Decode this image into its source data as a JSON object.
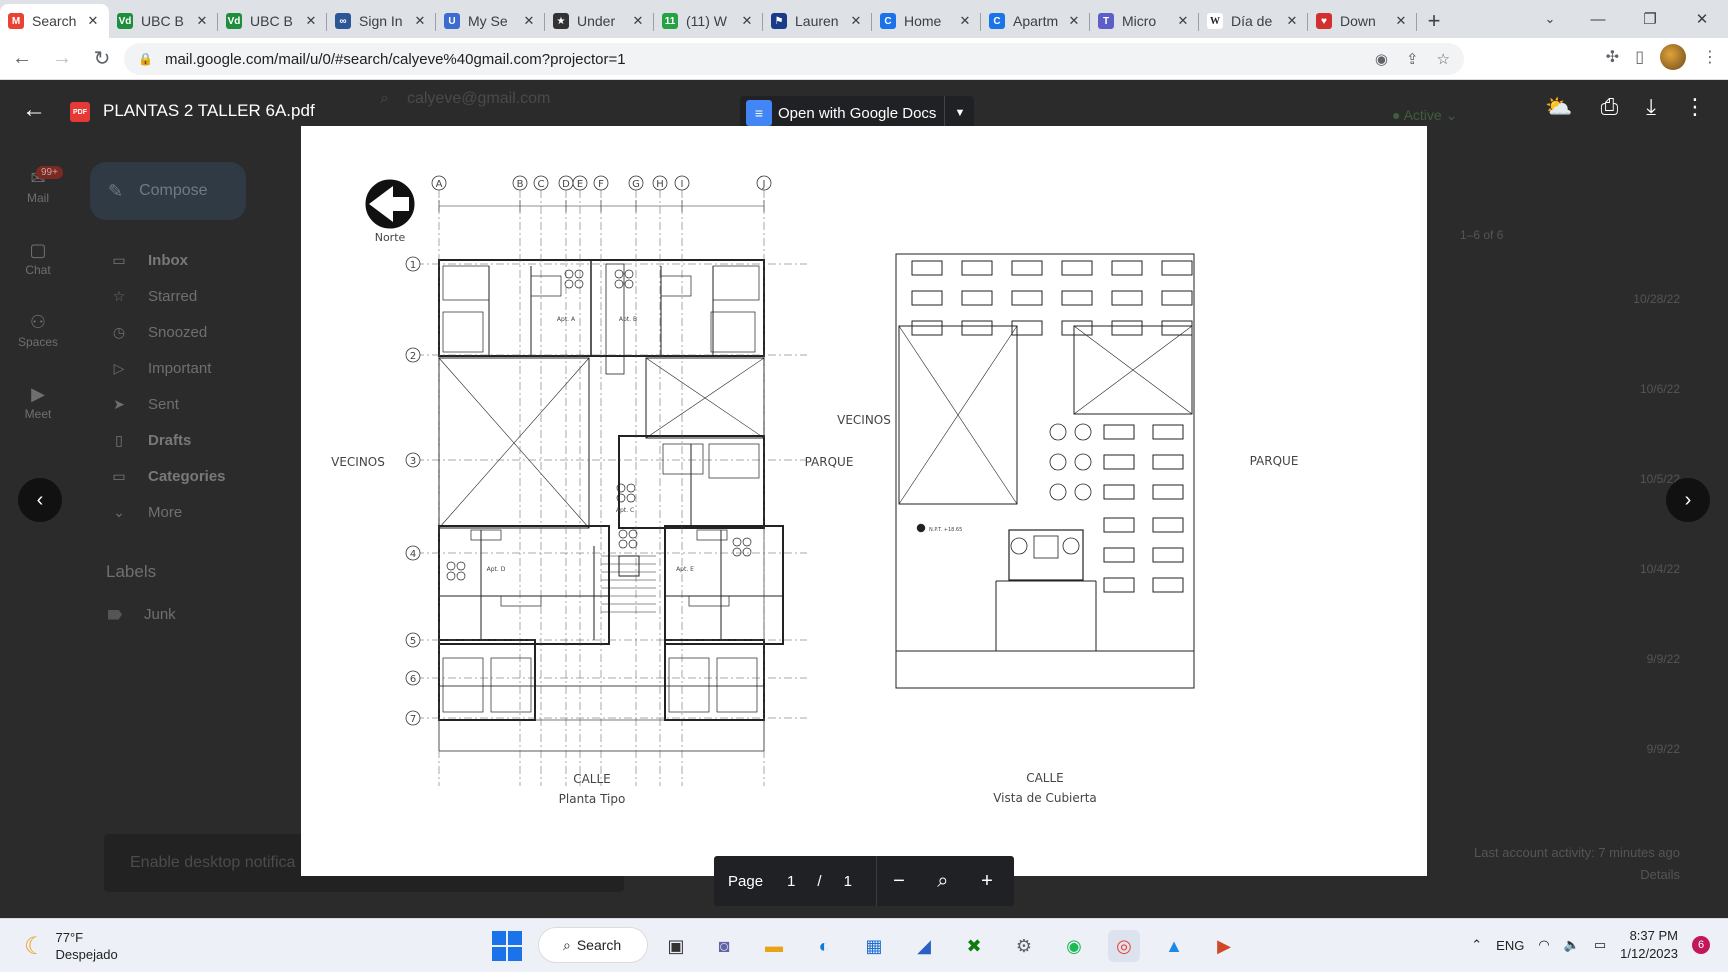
{
  "browser": {
    "tabs": [
      {
        "label": "Search",
        "fav": "M",
        "fav_color": "#ea4335",
        "active": true
      },
      {
        "label": "UBC B",
        "fav": "Vd",
        "fav_color": "#1e8e3e"
      },
      {
        "label": "UBC B",
        "fav": "Vd",
        "fav_color": "#1e8e3e"
      },
      {
        "label": "Sign In",
        "fav": "∞",
        "fav_color": "#2b5797"
      },
      {
        "label": "My Se",
        "fav": "U",
        "fav_color": "#3c6ccf"
      },
      {
        "label": "Under",
        "fav": "★",
        "fav_color": "#333333"
      },
      {
        "label": "(11) W",
        "fav": "11",
        "fav_color": "#25a244"
      },
      {
        "label": "Lauren",
        "fav": "⚑",
        "fav_color": "#1a3a8a"
      },
      {
        "label": "Home",
        "fav": "C",
        "fav_color": "#1a73e8"
      },
      {
        "label": "Apartm",
        "fav": "C",
        "fav_color": "#1a73e8"
      },
      {
        "label": "Micro",
        "fav": "T",
        "fav_color": "#5b5fc7"
      },
      {
        "label": "Día de",
        "fav": "W",
        "fav_color": "#ffffff"
      },
      {
        "label": "Down",
        "fav": "♥",
        "fav_color": "#d32f2f"
      }
    ],
    "new_tab_label": "+",
    "url": "mail.google.com/mail/u/0/#search/calyeve%40gmail.com?projector=1"
  },
  "gmail": {
    "rail": [
      {
        "label": "Mail",
        "icon": "mail-icon"
      },
      {
        "label": "Chat",
        "icon": "chat-icon"
      },
      {
        "label": "Spaces",
        "icon": "spaces-icon"
      },
      {
        "label": "Meet",
        "icon": "meet-icon"
      }
    ],
    "badge": "99+",
    "compose": "Compose",
    "nav": [
      {
        "label": "Inbox",
        "icon": "▭",
        "bold": true
      },
      {
        "label": "Starred",
        "icon": "☆",
        "bold": false
      },
      {
        "label": "Snoozed",
        "icon": "◷",
        "bold": false
      },
      {
        "label": "Important",
        "icon": "▷",
        "bold": false
      },
      {
        "label": "Sent",
        "icon": "➤",
        "bold": false
      },
      {
        "label": "Drafts",
        "icon": "▯",
        "bold": true
      },
      {
        "label": "Categories",
        "icon": "▭",
        "bold": true
      },
      {
        "label": "More",
        "icon": "⌄",
        "bold": false
      }
    ],
    "labels_heading": "Labels",
    "label_junk": "Junk",
    "search_query": "calyeve@gmail.com",
    "active_status": "Active",
    "pager": "1–6 of 6",
    "dates": [
      "10/28/22",
      "10/6/22",
      "10/5/22",
      "10/4/22",
      "9/9/22",
      "9/9/22"
    ],
    "notification": "Enable desktop notifica",
    "last_activity": "Last account activity: 7 minutes ago",
    "details": "Details"
  },
  "viewer": {
    "file_title": "PLANTAS 2 TALLER 6A.pdf",
    "file_icon_text": "PDF",
    "open_with": "Open with Google Docs",
    "page_label": "Page",
    "page_current": "1",
    "page_sep": "/",
    "page_total": "1"
  },
  "drawing": {
    "north_label": "Norte",
    "col_axes": [
      "A",
      "B",
      "C",
      "D",
      "E",
      "F",
      "G",
      "H",
      "I",
      "J"
    ],
    "row_axes": [
      "1",
      "2",
      "3",
      "4",
      "5",
      "6",
      "7"
    ],
    "apartments": [
      "Apt. A",
      "Apt. B",
      "Apt. C",
      "Apt. D",
      "Apt. E"
    ],
    "left_neighbors": "VECINOS",
    "right_park": "PARQUE",
    "street": "CALLE",
    "plan_title": "Planta Tipo",
    "roof_neighbors": "VECINOS",
    "roof_park": "PARQUE",
    "roof_street": "CALLE",
    "roof_title": "Vista de Cubierta",
    "level_mark": "N.P.T. +18.65"
  },
  "taskbar": {
    "temperature": "77°F",
    "weather": "Despejado",
    "search": "Search",
    "language": "ENG",
    "time": "8:37 PM",
    "date": "1/12/2023",
    "notifications": "6"
  },
  "colors": {
    "accent_blue": "#1a73e8",
    "pdf_red": "#e53935",
    "viewer_bg": "#1f1f1f"
  }
}
